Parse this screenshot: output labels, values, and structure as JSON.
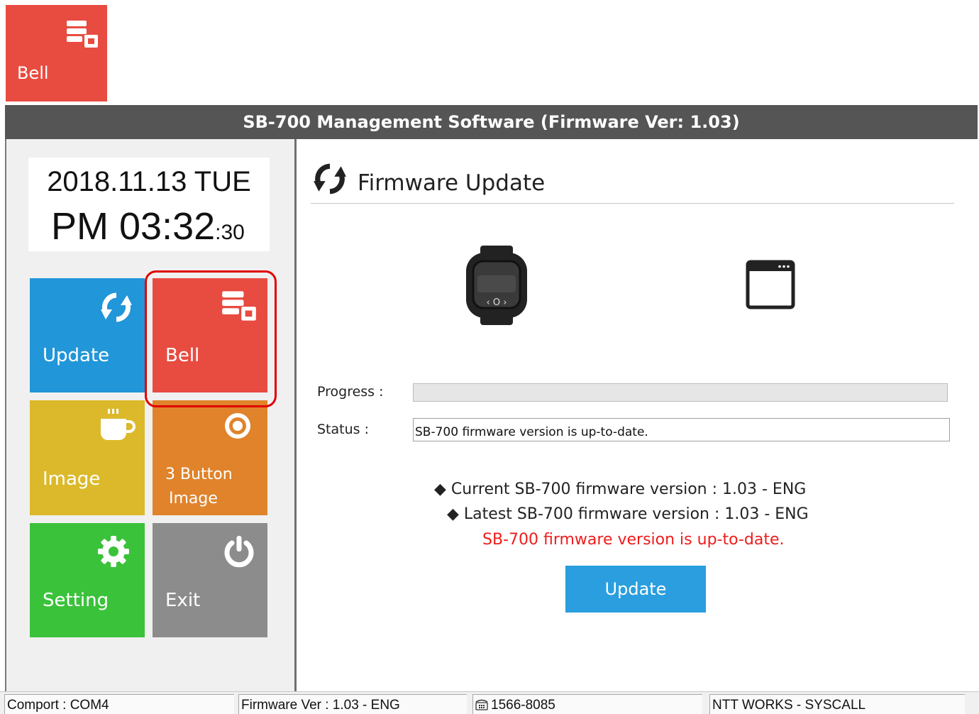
{
  "callout": {
    "label": "Bell",
    "icon": "database-icon"
  },
  "window": {
    "title": "SB-700 Management Software (Firmware Ver: 1.03)"
  },
  "clock": {
    "date": "2018.11.13 TUE",
    "time": "PM 03:32",
    "seconds": ":30"
  },
  "tiles": {
    "update": {
      "label": "Update",
      "icon": "refresh-icon",
      "color": "#2196d9"
    },
    "bell": {
      "label": "Bell",
      "icon": "database-icon",
      "color": "#e84b40"
    },
    "image": {
      "label": "Image",
      "icon": "coffee-cup-icon",
      "color": "#dbb92a"
    },
    "three_button": {
      "label_line1": "3 Button",
      "label_line2": "Image",
      "icon": "badge-icon",
      "color": "#e0832b"
    },
    "setting": {
      "label": "Setting",
      "icon": "gear-icon",
      "color": "#3bc23b"
    },
    "exit": {
      "label": "Exit",
      "icon": "power-icon",
      "color": "#8c8c8c"
    }
  },
  "main": {
    "title": "Firmware Update",
    "title_icon": "refresh-icon",
    "device_icon": "watch-icon",
    "target_icon": "window-icon",
    "progress_label": "Progress :",
    "progress_value": 0,
    "status_label": "Status :",
    "status_value": "SB-700 firmware version is up-to-date.",
    "current_version": "Current SB-700 firmware version : 1.03 - ENG",
    "latest_version": "Latest SB-700 firmware version : 1.03 - ENG",
    "message": "SB-700 firmware version is up-to-date.",
    "message_color": "#ee1c1c",
    "bullet": "◆",
    "update_button": "Update"
  },
  "statusbar": {
    "comport": "Comport : COM4",
    "firmware": "Firmware Ver : 1.03 - ENG",
    "phone_icon": "phone-icon",
    "phone": "1566-8085",
    "company": "NTT WORKS - SYSCALL"
  },
  "highlight_color": "#e00000"
}
